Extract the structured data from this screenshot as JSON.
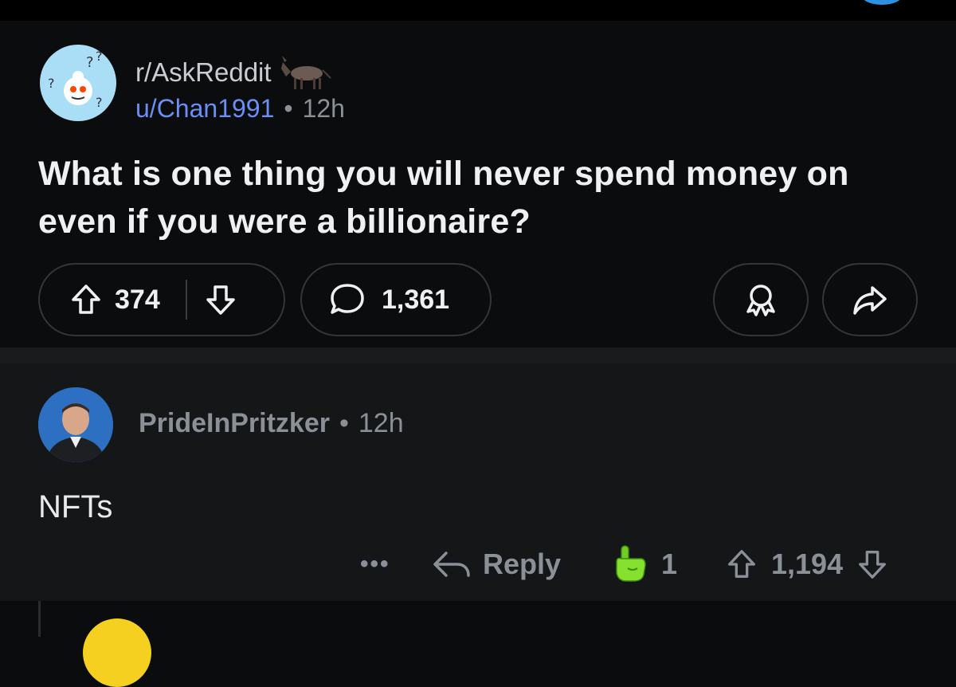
{
  "post": {
    "subreddit": "r/AskReddit",
    "author": "u/Chan1991",
    "age": "12h",
    "title": "What is one thing you will never spend money on even if you were a billionaire?",
    "upvotes": "374",
    "comments": "1,361"
  },
  "comment": {
    "author": "PrideInPritzker",
    "age": "12h",
    "body": "NFTs",
    "more_label": "•••",
    "reply_label": "Reply",
    "award_count": "1",
    "votes": "1,194"
  },
  "icons": {
    "sub_avatar": "reddit-snoo-confused-icon",
    "flair": "donkey-icon",
    "upvote": "arrow-up-icon",
    "downvote": "arrow-down-icon",
    "comment": "speech-bubble-icon",
    "award": "award-ribbon-icon",
    "share": "share-arrow-icon",
    "reply": "reply-arrow-icon",
    "award_given": "pointing-hand-award-icon"
  }
}
